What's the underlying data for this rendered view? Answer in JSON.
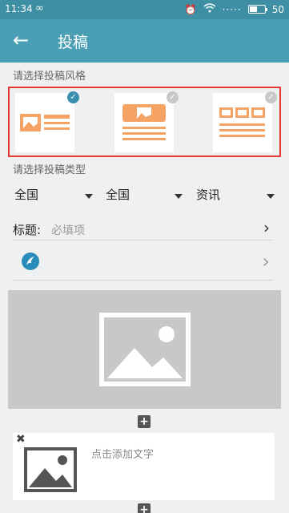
{
  "status": {
    "time": "11:34",
    "battery": "50",
    "battery_level": 0.5
  },
  "header": {
    "title": "投稿",
    "back_icon": "arrow-left-icon"
  },
  "style_section": {
    "label": "请选择投稿风格",
    "options": [
      {
        "layout": "image-left",
        "selected": true
      },
      {
        "layout": "image-top",
        "selected": false
      },
      {
        "layout": "three-images",
        "selected": false
      }
    ]
  },
  "type_section": {
    "label": "请选择投稿类型",
    "selects": [
      "全国",
      "全国",
      "资讯"
    ]
  },
  "title_field": {
    "label": "标题:",
    "placeholder": "必填项"
  },
  "colors": {
    "accent": "#4a9fb5",
    "style_orange": "#f5a365",
    "selected_check": "#3a8fb0",
    "highlight": "#e53935"
  },
  "text_block": {
    "placeholder": "点击添加文字"
  }
}
